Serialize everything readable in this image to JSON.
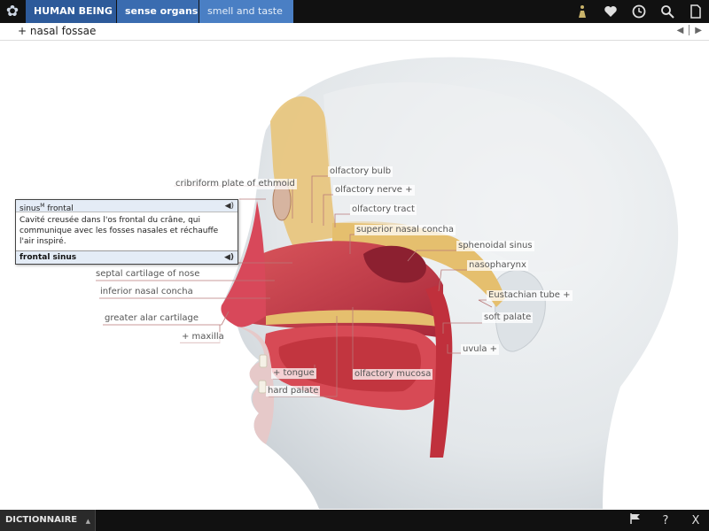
{
  "topbar": {
    "logo": "flower-logo-icon",
    "breadcrumbs": [
      "HUMAN BEING",
      "sense organs",
      "smell and taste"
    ],
    "icons": [
      "figure-icon",
      "heart-icon",
      "clock-icon",
      "search-icon",
      "document-icon"
    ],
    "colors": {
      "crumb1": "#2d5a9a",
      "crumb2": "#3a6cb0",
      "crumb3": "#4a7fc4"
    }
  },
  "titlebar": {
    "title": "+ nasal fossae"
  },
  "labels": {
    "cribriform": "cribriform plate of ethmoid",
    "olfactory_bulb": "olfactory bulb",
    "olfactory_nerve": "olfactory nerve +",
    "olfactory_tract": "olfactory tract",
    "superior_concha": "superior nasal concha",
    "sphenoidal_sinus": "sphenoidal sinus",
    "nasopharynx": "nasopharynx",
    "eustachian_tube": "Eustachian tube +",
    "soft_palate": "soft palate",
    "uvula": "uvula +",
    "olfactory_mucosa": "olfactory mucosa",
    "hard_palate": "hard palate",
    "tongue": "+ tongue",
    "maxilla": "+ maxilla",
    "greater_alar": "greater alar cartilage",
    "inferior_concha": "inferior nasal concha",
    "septal_cartilage": "septal cartilage of nose"
  },
  "popup": {
    "term": "sinus",
    "gender": "M",
    "term_rest": " frontal",
    "definition": "Cavité creusée dans l'os frontal du crâne, qui communique avec les fosses nasales et réchauffe l'air inspiré.",
    "translation": "frontal sinus"
  },
  "bottombar": {
    "dictionary_label": "DICTIONNAIRE",
    "close_label": "X",
    "help_label": "?"
  }
}
